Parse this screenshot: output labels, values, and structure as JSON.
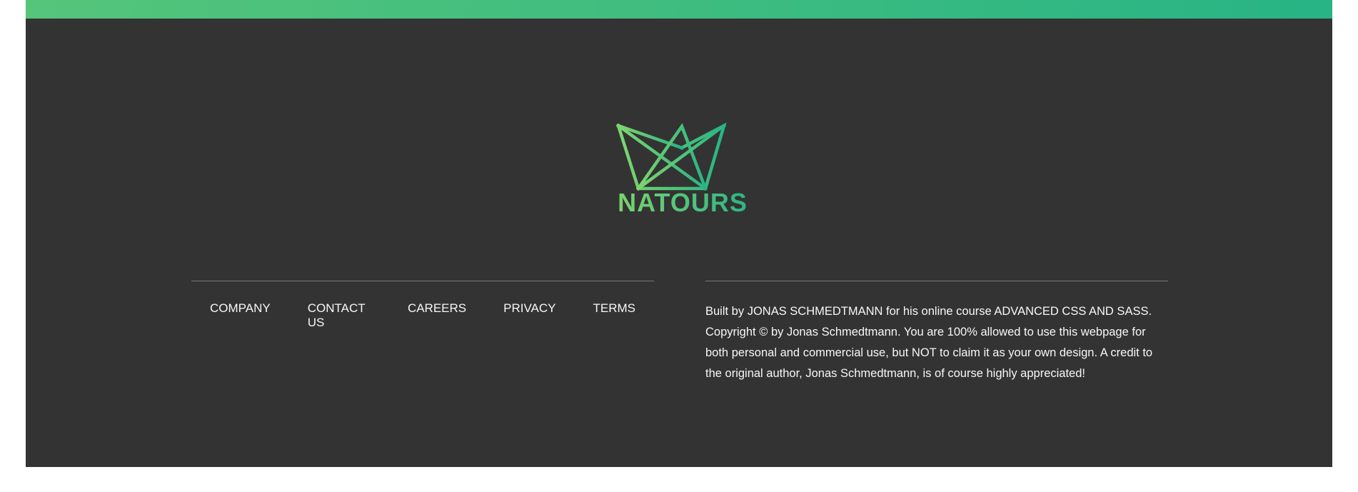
{
  "colors": {
    "gradient_start": "#55c57a",
    "gradient_end": "#28b485",
    "logo_light": "#7ed56f",
    "footer_bg": "#333333",
    "text": "#f7f7f7",
    "rule": "#777777"
  },
  "logo": {
    "icon": "crown-logo-icon",
    "text": "NATOURS"
  },
  "nav": {
    "items": [
      {
        "label": "Company"
      },
      {
        "label": "Contact us"
      },
      {
        "label": "Careers"
      },
      {
        "label": "Privacy"
      },
      {
        "label": "Terms"
      }
    ]
  },
  "copyright": {
    "text": "Built by JONAS SCHMEDTMANN for his online course ADVANCED CSS AND SASS. Copyright © by Jonas Schmedtmann. You are 100% allowed to use this webpage for both personal and commercial use, but NOT to claim it as your own design. A credit to the original author, Jonas Schmedtmann, is of course highly appreciated!"
  }
}
